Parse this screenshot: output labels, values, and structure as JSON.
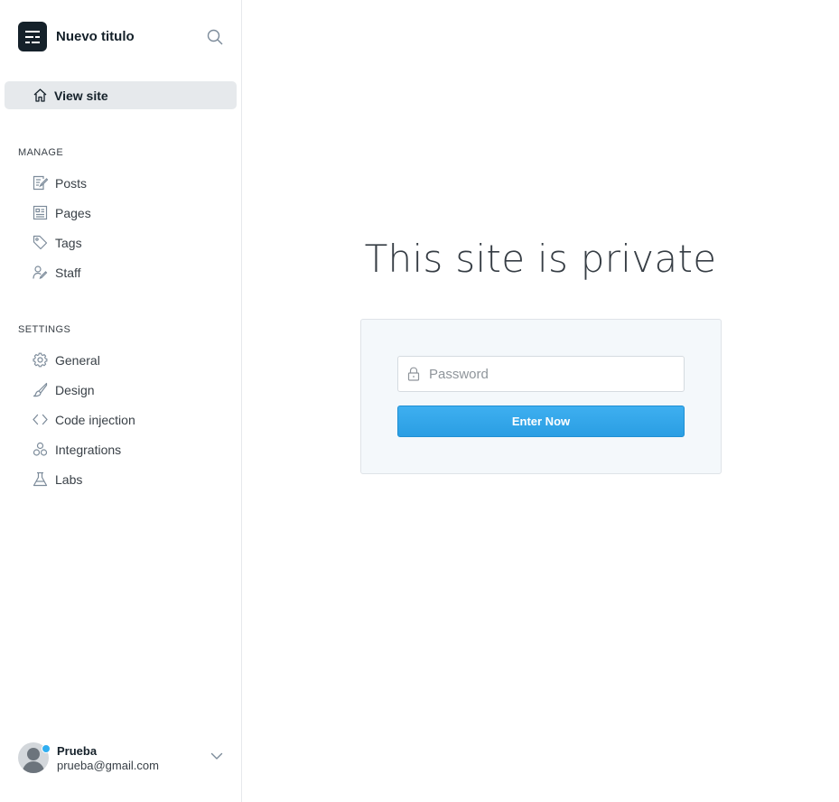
{
  "sidebar": {
    "site_title": "Nuevo titulo",
    "view_site": "View site",
    "manage_title": "MANAGE",
    "manage_items": [
      {
        "label": "Posts",
        "icon": "posts-icon"
      },
      {
        "label": "Pages",
        "icon": "pages-icon"
      },
      {
        "label": "Tags",
        "icon": "tag-icon"
      },
      {
        "label": "Staff",
        "icon": "staff-icon"
      }
    ],
    "settings_title": "SETTINGS",
    "settings_items": [
      {
        "label": "General",
        "icon": "gear-icon"
      },
      {
        "label": "Design",
        "icon": "brush-icon"
      },
      {
        "label": "Code injection",
        "icon": "code-icon"
      },
      {
        "label": "Integrations",
        "icon": "integrations-icon"
      },
      {
        "label": "Labs",
        "icon": "flask-icon"
      }
    ],
    "user": {
      "name": "Prueba",
      "email": "prueba@gmail.com"
    }
  },
  "main": {
    "heading": "This site is private",
    "password_placeholder": "Password",
    "enter_button": "Enter Now"
  },
  "colors": {
    "accent": "#30aef0",
    "brand": "#15212a",
    "active_bg": "#e6e9ec"
  }
}
